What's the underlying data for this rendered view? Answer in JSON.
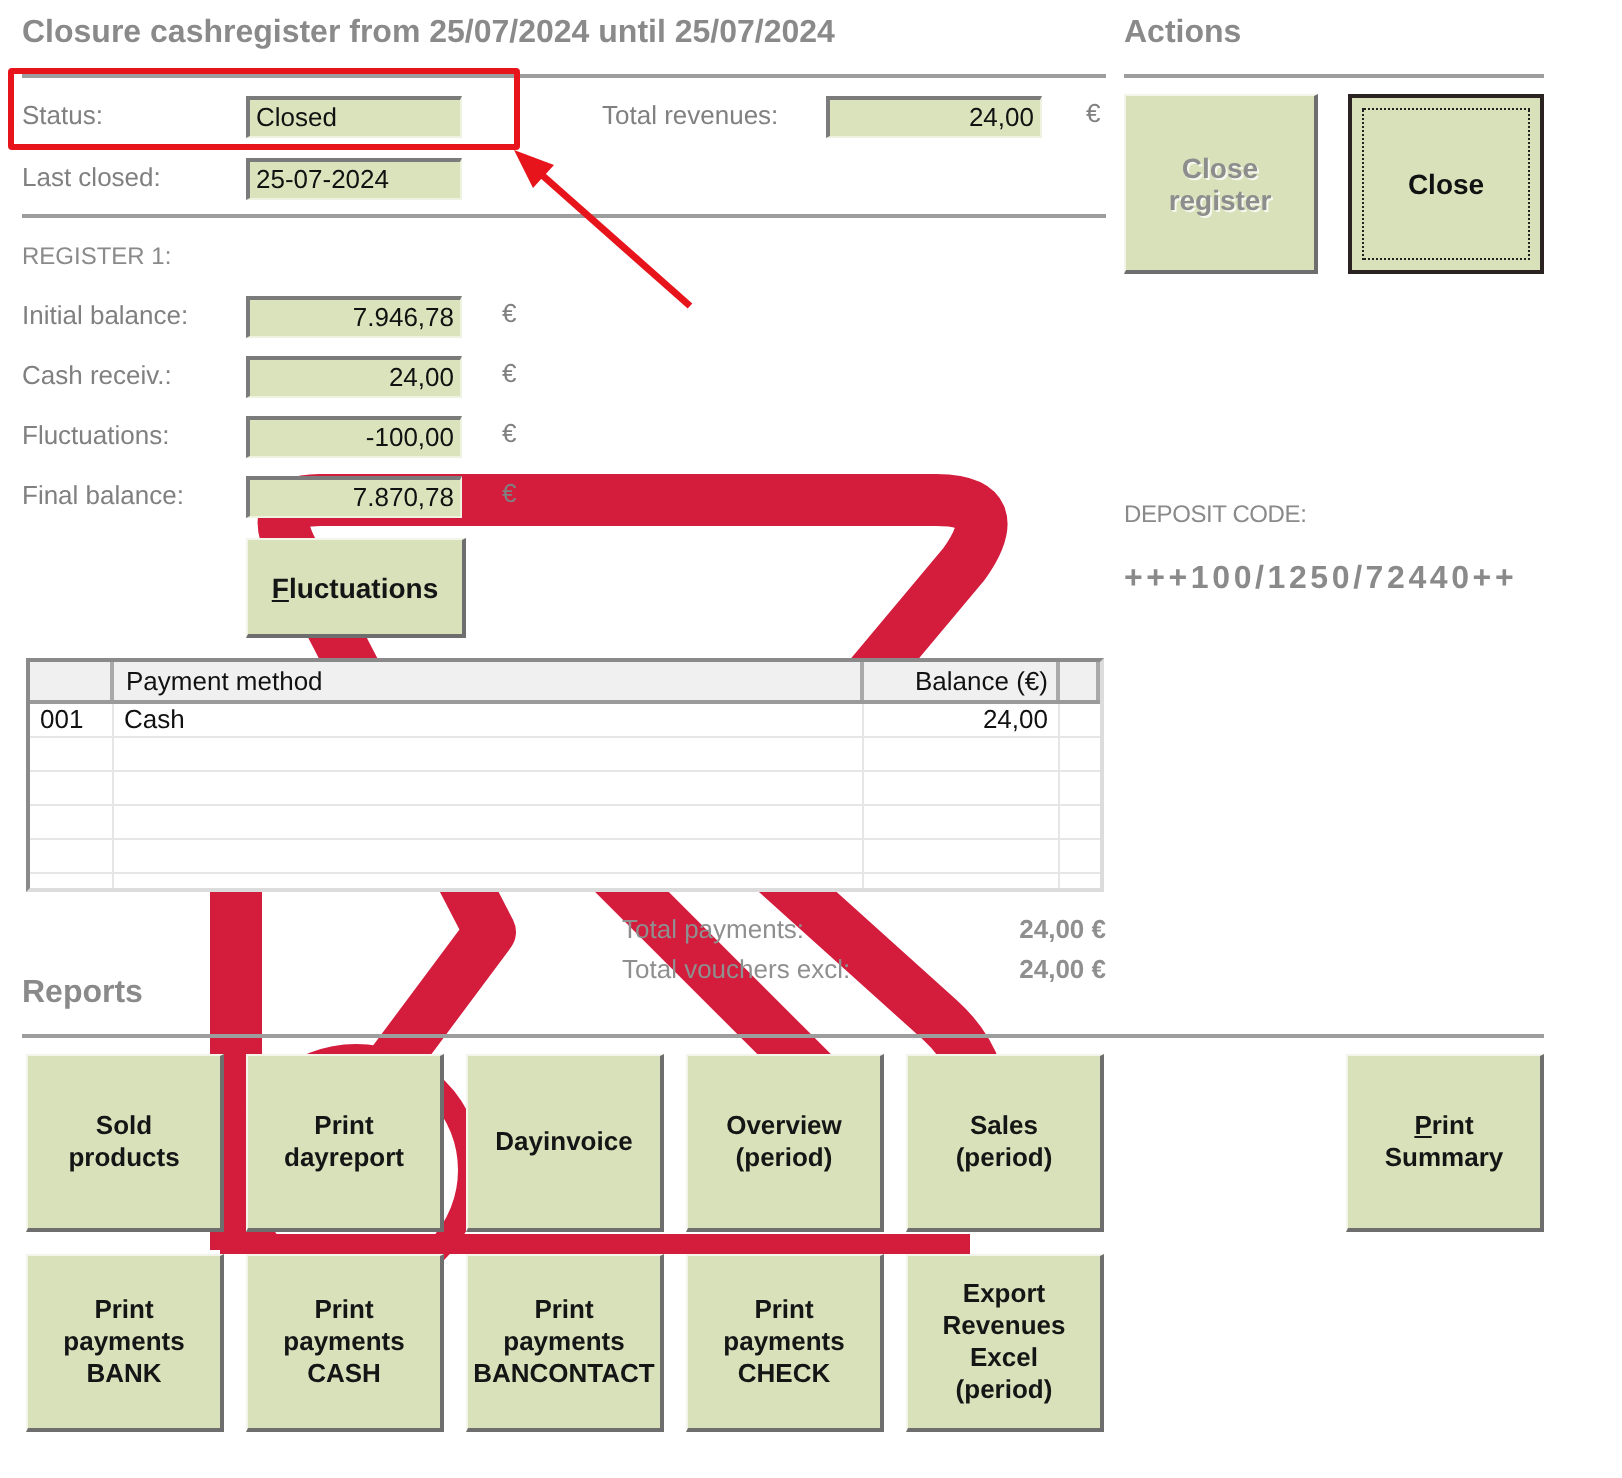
{
  "title": "Closure cashregister from 25/07/2024 until 25/07/2024",
  "summary": {
    "fields": [
      {
        "label": "Status:",
        "value": "Closed",
        "highlighted": true
      },
      {
        "label": "Last closed:",
        "value": "25-07-2024",
        "highlighted": false
      }
    ],
    "total": {
      "label": "Total revenues:",
      "value": "24,00",
      "currency": "€"
    }
  },
  "callout_arrow": true,
  "register": {
    "heading": "REGISTER 1:",
    "fields": [
      {
        "label": "Initial balance:",
        "value": "7.946,78",
        "currency": "€"
      },
      {
        "label": "Cash receiv.:",
        "value": "24,00",
        "currency": "€"
      },
      {
        "label": "Fluctuations:",
        "value": "-100,00",
        "currency": "€"
      },
      {
        "label": "Final balance:",
        "value": "7.870,78",
        "currency": "€"
      }
    ],
    "button": {
      "label": "Fluctuations",
      "mnemonic": true
    }
  },
  "table": {
    "columns": [
      "Payment method",
      "Balance (€)"
    ],
    "rows": [
      {
        "code": "001",
        "method": "Cash",
        "balance": "24,00"
      }
    ]
  },
  "totals": [
    {
      "label": "Total payments:",
      "value": "24,00 €"
    },
    {
      "label": "Total vouchers excl:",
      "value": "24,00 €"
    }
  ],
  "actions": {
    "heading": "Actions",
    "buttons": [
      {
        "label": "Close register",
        "disabled": true,
        "focused": false
      },
      {
        "label": "Close",
        "disabled": false,
        "focused": true
      }
    ]
  },
  "deposit": {
    "label": "DEPOSIT CODE:",
    "code": "+++100/1250/72440++"
  },
  "reports": {
    "heading": "Reports",
    "buttons": [
      {
        "label": "Sold products",
        "mnemonic": false
      },
      {
        "label": "Print dayreport",
        "mnemonic": false
      },
      {
        "label": "Dayinvoice",
        "mnemonic": false
      },
      {
        "label": "Overview (period)",
        "mnemonic": false
      },
      {
        "label": "Sales (period)",
        "mnemonic": false
      },
      {
        "label": "Print payments BANK",
        "mnemonic": false
      },
      {
        "label": "Print payments CASH",
        "mnemonic": false
      },
      {
        "label": "Print payments BANCONTACT",
        "mnemonic": false
      },
      {
        "label": "Print payments CHECK",
        "mnemonic": false
      },
      {
        "label": "Export Revenues Excel (period)",
        "mnemonic": false
      }
    ],
    "side_button": {
      "label": "Print Summary",
      "mnemonic": true
    }
  }
}
